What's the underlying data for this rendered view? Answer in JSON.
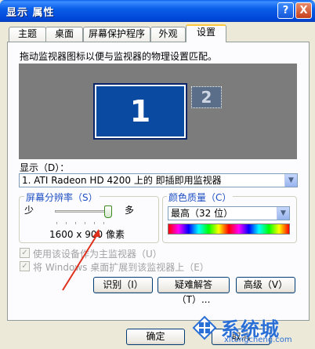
{
  "window": {
    "title": "显示 属性",
    "help_label": "?",
    "close_label": "X"
  },
  "tabs": [
    {
      "label": "主题"
    },
    {
      "label": "桌面"
    },
    {
      "label": "屏幕保护程序"
    },
    {
      "label": "外观"
    },
    {
      "label": "设置"
    }
  ],
  "settings": {
    "instruction": "拖动监视器图标以便与监视器的物理设置匹配。",
    "monitor1_label": "1",
    "monitor2_label": "2",
    "display_label": "显示（D）：",
    "display_value": "1. ATI Radeon HD 4200 上的 即插即用监视器",
    "resolution": {
      "group_label": "屏幕分辨率（S）",
      "less_label": "少",
      "more_label": "多",
      "value_text": "1600 x 900 像素"
    },
    "color_quality": {
      "group_label": "颜色质量（C）",
      "selected": "最高（32 位）"
    },
    "checkboxes": [
      {
        "label": "使用该设备作为主监视器（U）",
        "checked": true
      },
      {
        "label": "将 Windows 桌面扩展到该监视器上（E）",
        "checked": true
      }
    ],
    "buttons": {
      "identify": "识别（I）",
      "troubleshoot": "疑难解答（T）...",
      "advanced": "高级（V）"
    }
  },
  "footer": {
    "ok": "确定",
    "cancel": "取消"
  },
  "watermark": {
    "brand": "系统城",
    "url": "xitongcheng.com"
  },
  "colors": {
    "titlebar_blue": "#0a5ee8",
    "desktop_gray": "#7c7c7c",
    "monitor_blue": "#0b4aa1",
    "annotation_arrow": "#e0301e",
    "watermark_blue": "#2a6fd6"
  }
}
